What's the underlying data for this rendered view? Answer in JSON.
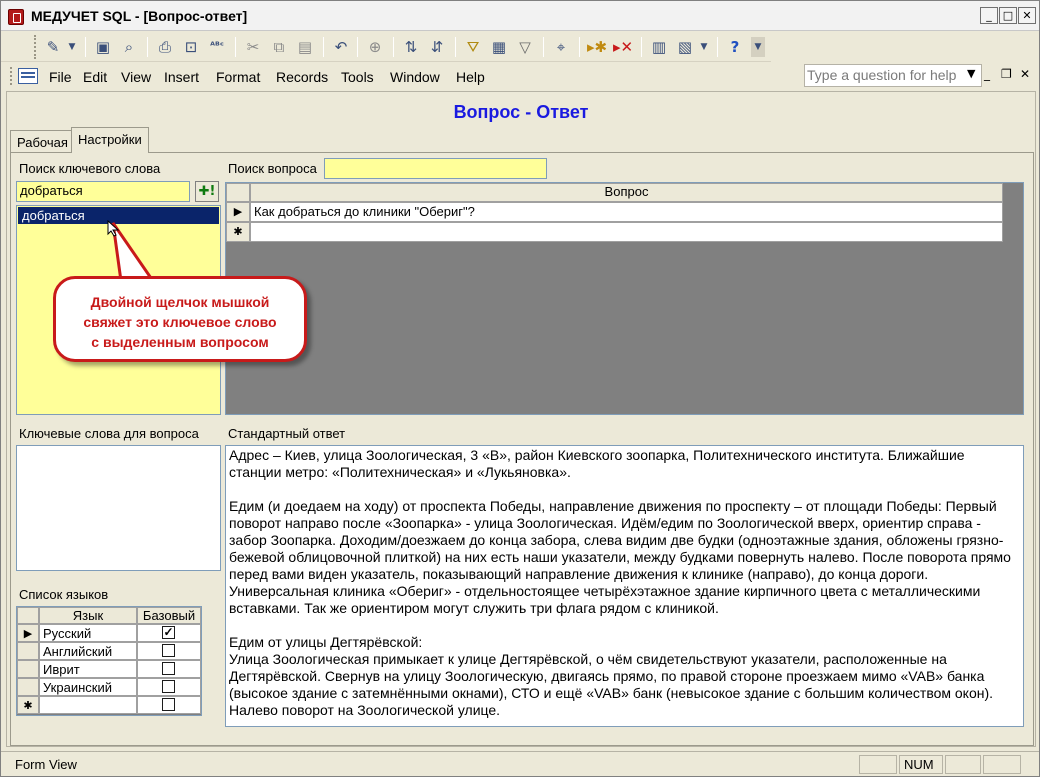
{
  "window": {
    "title": "МЕДУЧЕТ SQL - [Вопрос-ответ]",
    "minimize": "_",
    "maximize": "□",
    "close": "✕"
  },
  "toolbar": {
    "icons": [
      "design-view-icon",
      "save-icon",
      "file-search-icon",
      "print-icon",
      "print-preview-icon",
      "spelling-icon",
      "cut-icon",
      "copy-icon",
      "paste-icon",
      "undo-icon",
      "insert-hyperlink-icon",
      "sort-ascending-icon",
      "sort-descending-icon",
      "filter-by-selection-icon",
      "filter-by-form-icon",
      "apply-filter-icon",
      "find-icon",
      "new-record-icon",
      "delete-record-icon",
      "database-window-icon",
      "new-object-icon",
      "help-icon"
    ]
  },
  "menu": {
    "items": [
      "File",
      "Edit",
      "View",
      "Insert",
      "Format",
      "Records",
      "Tools",
      "Window",
      "Help"
    ],
    "help_placeholder": "Type a question for help"
  },
  "form": {
    "title": "Вопрос - Ответ",
    "tabs": [
      "Рабочая",
      "Настройки"
    ],
    "keyword_search_label": "Поиск ключевого слова",
    "keyword_value": "добраться",
    "keyword_list": [
      "добраться"
    ],
    "add_button": "✚!",
    "question_search_label": "Поиск вопроса",
    "question_search_value": "",
    "questions_header": "Вопрос",
    "questions": [
      "Как добраться до клиники \"Обериг\"?"
    ],
    "callout": [
      "Двойной щелчок мышкой",
      "свяжет это ключевое слово",
      "с выделенным вопросом"
    ],
    "keywords_for_question_label": "Ключевые слова для вопроса",
    "standard_answer_label": "Стандартный ответ",
    "answer_text": "Адрес – Киев, улица Зоологическая, 3 «В», район Киевского зоопарка, Политехнического института. Ближайшие станции метро: «Политехническая» и «Лукьяновка».\n\nЕдим (и доедаем на ходу) от проспекта Победы, направление движения по проспекту – от площади Победы: Первый поворот направо после «Зоопарка» - улица Зоологическая. Идём/едим по Зоологической вверх, ориентир справа - забор Зоопарка. Доходим/доезжаем до конца забора, слева видим две будки (одноэтажные здания, обложены грязно-бежевой облицовочной плиткой) на них есть наши указатели, между будками повернуть налево. После поворота прямо перед вами виден указатель, показывающий направление движения к клинике (направо), до конца дороги. Универсальная клиника «Обериг» - отдельностоящее четырёхэтажное здание кирпичного цвета с металлическими вставками. Так же ориентиром могут служить три флага рядом с клиникой.\n\nЕдим от улицы Дегтярёвской:\nУлица Зоологическая примыкает к улице Дегтярёвской, о чём свидетельствуют указатели, расположенные на Дегтярёвской. Свернув на улицу Зоологическую, двигаясь прямо, по правой стороне проезжаем мимо «VAB» банка (высокое здание с затемнёнными окнами), СТО и ещё «VAB» банк (невысокое здание с большим количеством окон). Налево поворот на Зоологической улице.",
    "languages_label": "Список языков",
    "lang_headers": [
      "Язык",
      "Базовый"
    ],
    "languages": [
      {
        "name": "Русский",
        "base": true
      },
      {
        "name": "Английский",
        "base": false
      },
      {
        "name": "Иврит",
        "base": false
      },
      {
        "name": "Украинский",
        "base": false
      }
    ]
  },
  "status": {
    "view": "Form View",
    "num": "NUM"
  }
}
